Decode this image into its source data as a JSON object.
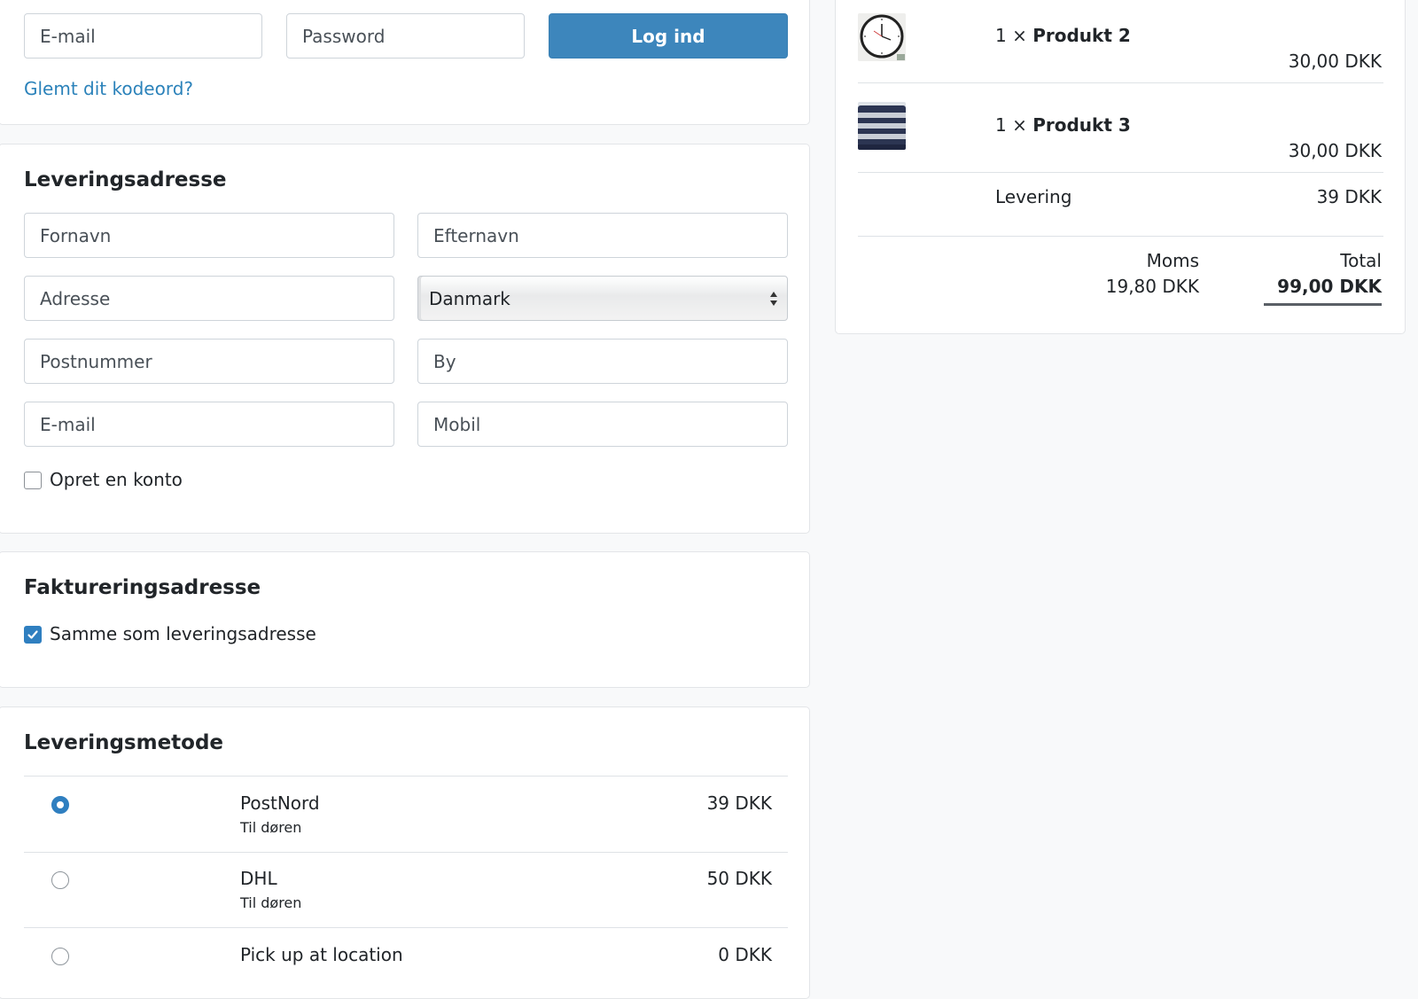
{
  "login": {
    "email_placeholder": "E-mail",
    "password_placeholder": "Password",
    "login_button": "Log ind",
    "forgot_link": "Glemt dit kodeord?"
  },
  "shipping": {
    "heading": "Leveringsadresse",
    "firstname_placeholder": "Fornavn",
    "lastname_placeholder": "Efternavn",
    "address_placeholder": "Adresse",
    "country_selected": "Danmark",
    "zip_placeholder": "Postnummer",
    "city_placeholder": "By",
    "email_placeholder": "E-mail",
    "mobile_placeholder": "Mobil",
    "create_account_label": "Opret en konto",
    "create_account_checked": false
  },
  "billing": {
    "heading": "Faktureringsadresse",
    "same_as_shipping_label": "Samme som leveringsadresse",
    "same_as_shipping_checked": true
  },
  "delivery": {
    "heading": "Leveringsmetode",
    "methods": [
      {
        "name": "PostNord",
        "desc": "Til døren",
        "price": "39 DKK",
        "selected": true
      },
      {
        "name": "DHL",
        "desc": "Til døren",
        "price": "50 DKK",
        "selected": false
      },
      {
        "name": "Pick up at location",
        "desc": "",
        "price": "0 DKK",
        "selected": false
      }
    ]
  },
  "summary": {
    "items": [
      {
        "qty": "1 ×",
        "name": "Produkt 2",
        "price": "30,00 DKK",
        "image": "clock-image"
      },
      {
        "qty": "1 ×",
        "name": "Produkt 3",
        "price": "30,00 DKK",
        "image": "sweater-image"
      }
    ],
    "delivery_label": "Levering",
    "delivery_price": "39 DKK",
    "vat_label": "Moms",
    "vat_value": "19,80 DKK",
    "total_label": "Total",
    "total_value": "99,00 DKK"
  },
  "colors": {
    "primary": "#3d86bc",
    "link": "#2b82ba",
    "background": "#f8f9fa"
  }
}
